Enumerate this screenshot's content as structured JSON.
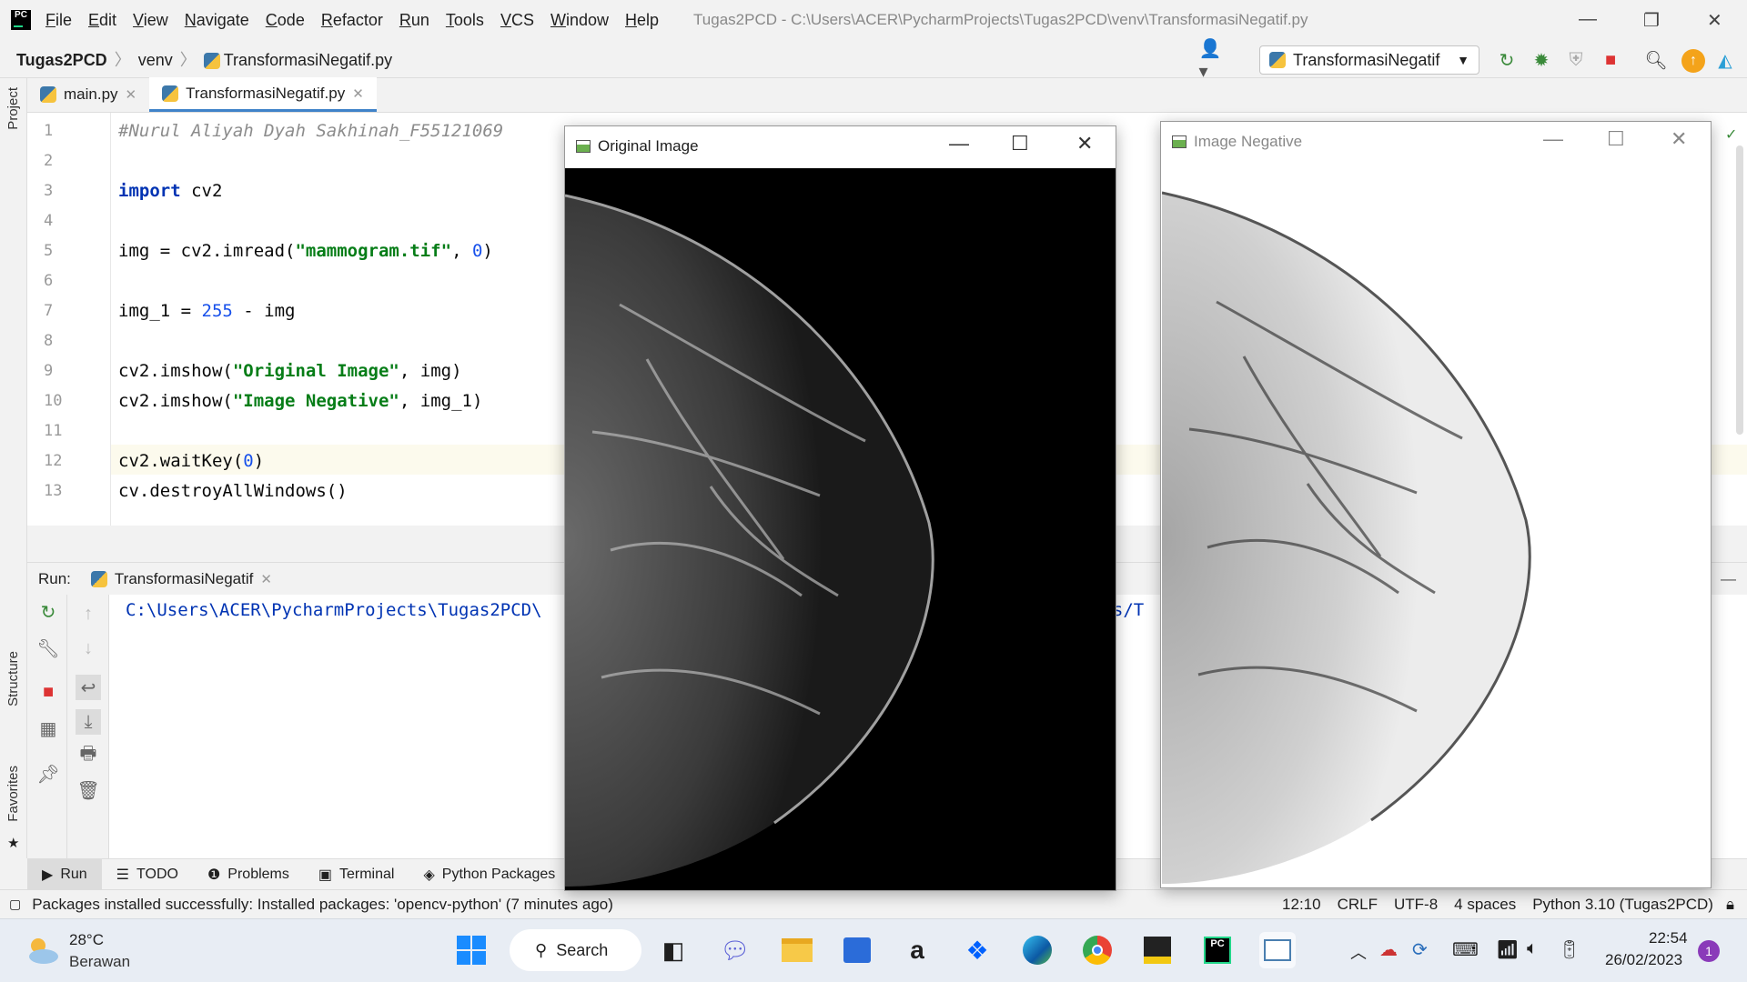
{
  "titlebar": {
    "menu": [
      "File",
      "Edit",
      "View",
      "Navigate",
      "Code",
      "Refactor",
      "Run",
      "Tools",
      "VCS",
      "Window",
      "Help"
    ],
    "title": "Tugas2PCD - C:\\Users\\ACER\\PycharmProjects\\Tugas2PCD\\venv\\TransformasiNegatif.py"
  },
  "navbar": {
    "project": "Tugas2PCD",
    "folder": "venv",
    "file": "TransformasiNegatif.py",
    "run_config": "TransformasiNegatif"
  },
  "sidebar": {
    "project": "Project",
    "structure": "Structure",
    "favorites": "Favorites"
  },
  "tabs": [
    {
      "label": "main.py"
    },
    {
      "label": "TransformasiNegatif.py"
    }
  ],
  "code": {
    "line_numbers": [
      "1",
      "2",
      "3",
      "4",
      "5",
      "6",
      "7",
      "8",
      "9",
      "10",
      "11",
      "12",
      "13"
    ],
    "l1": "#Nurul Aliyah Dyah Sakhinah_F55121069",
    "l3_kw": "import",
    "l3_rest": " cv2",
    "l5_a": "img = cv2.imread(",
    "l5_str": "\"mammogram.tif\"",
    "l5_b": ", ",
    "l5_num": "0",
    "l5_c": ")",
    "l7_a": "img_1 = ",
    "l7_num": "255",
    "l7_b": " - img",
    "l9_a": "cv2.imshow(",
    "l9_str": "\"Original Image\"",
    "l9_b": ", img)",
    "l10_a": "cv2.imshow(",
    "l10_str": "\"Image Negative\"",
    "l10_b": ", img_1)",
    "l12_a": "cv2.waitKey(",
    "l12_num": "0",
    "l12_b": ")",
    "l13": "cv.destroyAllWindows()"
  },
  "run": {
    "label": "Run:",
    "tab": "TransformasiNegatif",
    "console_left": "C:\\Users\\ACER\\PycharmProjects\\Tugas2PCD\\",
    "console_right": "cts/T"
  },
  "bottom_tabs": [
    "Run",
    "TODO",
    "Problems",
    "Terminal",
    "Python Packages"
  ],
  "status": {
    "message": "Packages installed successfully: Installed packages: 'opencv-python' (7 minutes ago)",
    "position": "12:10",
    "line_sep": "CRLF",
    "encoding": "UTF-8",
    "indent": "4 spaces",
    "interpreter": "Python 3.10 (Tugas2PCD)"
  },
  "windows": {
    "original": "Original Image",
    "negative": "Image Negative"
  },
  "taskbar": {
    "temp": "28°C",
    "weather": "Berawan",
    "search": "Search",
    "time": "22:54",
    "date": "26/02/2023",
    "notif": "1"
  }
}
